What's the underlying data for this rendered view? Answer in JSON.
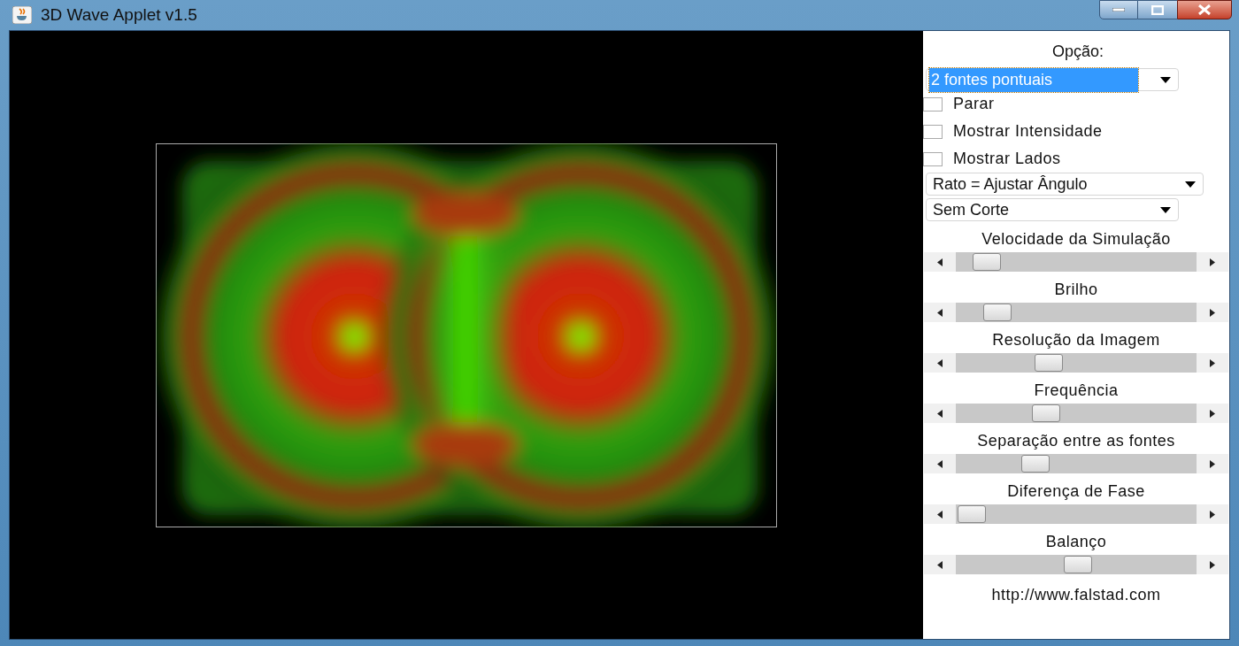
{
  "window": {
    "title": "3D Wave Applet v1.5"
  },
  "panel": {
    "option_label": "Opção:",
    "option_select": {
      "value": "2 fontes pontuais",
      "focused": true
    },
    "checkboxes": [
      {
        "label": "Parar",
        "checked": false
      },
      {
        "label": "Mostrar Intensidade",
        "checked": false
      },
      {
        "label": "Mostrar Lados",
        "checked": false
      }
    ],
    "selects": [
      {
        "value": "Rato = Ajustar Ângulo"
      },
      {
        "value": "Sem Corte"
      }
    ],
    "sliders": [
      {
        "label": "Velocidade da Simulação",
        "level": 0.08
      },
      {
        "label": "Brilho",
        "level": 0.13
      },
      {
        "label": "Resolução da Imagem",
        "level": 0.37
      },
      {
        "label": "Frequência",
        "level": 0.36
      },
      {
        "label": "Separação entre as fontes",
        "level": 0.31
      },
      {
        "label": "Diferença de Fase",
        "level": 0.01
      },
      {
        "label": "Balanço",
        "level": 0.51
      }
    ],
    "link": "http://www.falstad.com"
  }
}
